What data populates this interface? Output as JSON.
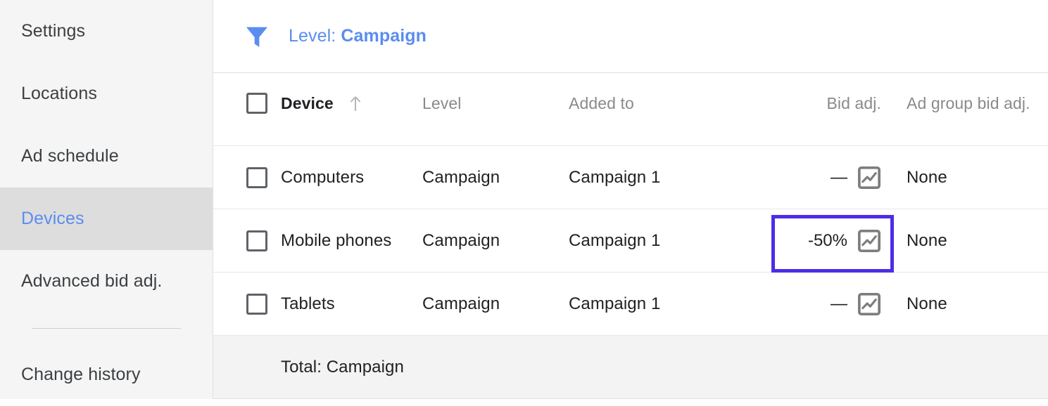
{
  "sidebar": {
    "items": [
      {
        "label": "Settings",
        "active": false
      },
      {
        "label": "Locations",
        "active": false
      },
      {
        "label": "Ad schedule",
        "active": false
      },
      {
        "label": "Devices",
        "active": true
      },
      {
        "label": "Advanced bid adj.",
        "active": false
      }
    ],
    "after_divider": [
      {
        "label": "Change history",
        "active": false
      }
    ]
  },
  "filter": {
    "icon": "filter-funnel-icon",
    "label_prefix": "Level:",
    "label_value": "Campaign",
    "color": "#5b8def"
  },
  "table": {
    "columns": [
      {
        "key": "select",
        "label": ""
      },
      {
        "key": "device",
        "label": "Device",
        "sorted": true,
        "sort_direction": "asc",
        "sort_icon": "arrow-up-icon"
      },
      {
        "key": "level",
        "label": "Level"
      },
      {
        "key": "added_to",
        "label": "Added to"
      },
      {
        "key": "bid_adj",
        "label": "Bid adj."
      },
      {
        "key": "ad_group_bid_adj",
        "label": "Ad group bid adj."
      }
    ],
    "rows": [
      {
        "device": "Computers",
        "level": "Campaign",
        "added_to": "Campaign 1",
        "bid_adj": "—",
        "bid_adj_icon": "chart-icon",
        "ad_group_bid_adj": "None",
        "highlighted": false
      },
      {
        "device": "Mobile phones",
        "level": "Campaign",
        "added_to": "Campaign 1",
        "bid_adj": "-50%",
        "bid_adj_icon": "chart-icon",
        "ad_group_bid_adj": "None",
        "highlighted": true
      },
      {
        "device": "Tablets",
        "level": "Campaign",
        "added_to": "Campaign 1",
        "bid_adj": "—",
        "bid_adj_icon": "chart-icon",
        "ad_group_bid_adj": "None",
        "highlighted": false
      }
    ],
    "total_row": {
      "label": "Total: Campaign"
    }
  },
  "highlight": {
    "color": "#4b2ee8",
    "target": "bid-adj-cell-mobile-phones"
  }
}
